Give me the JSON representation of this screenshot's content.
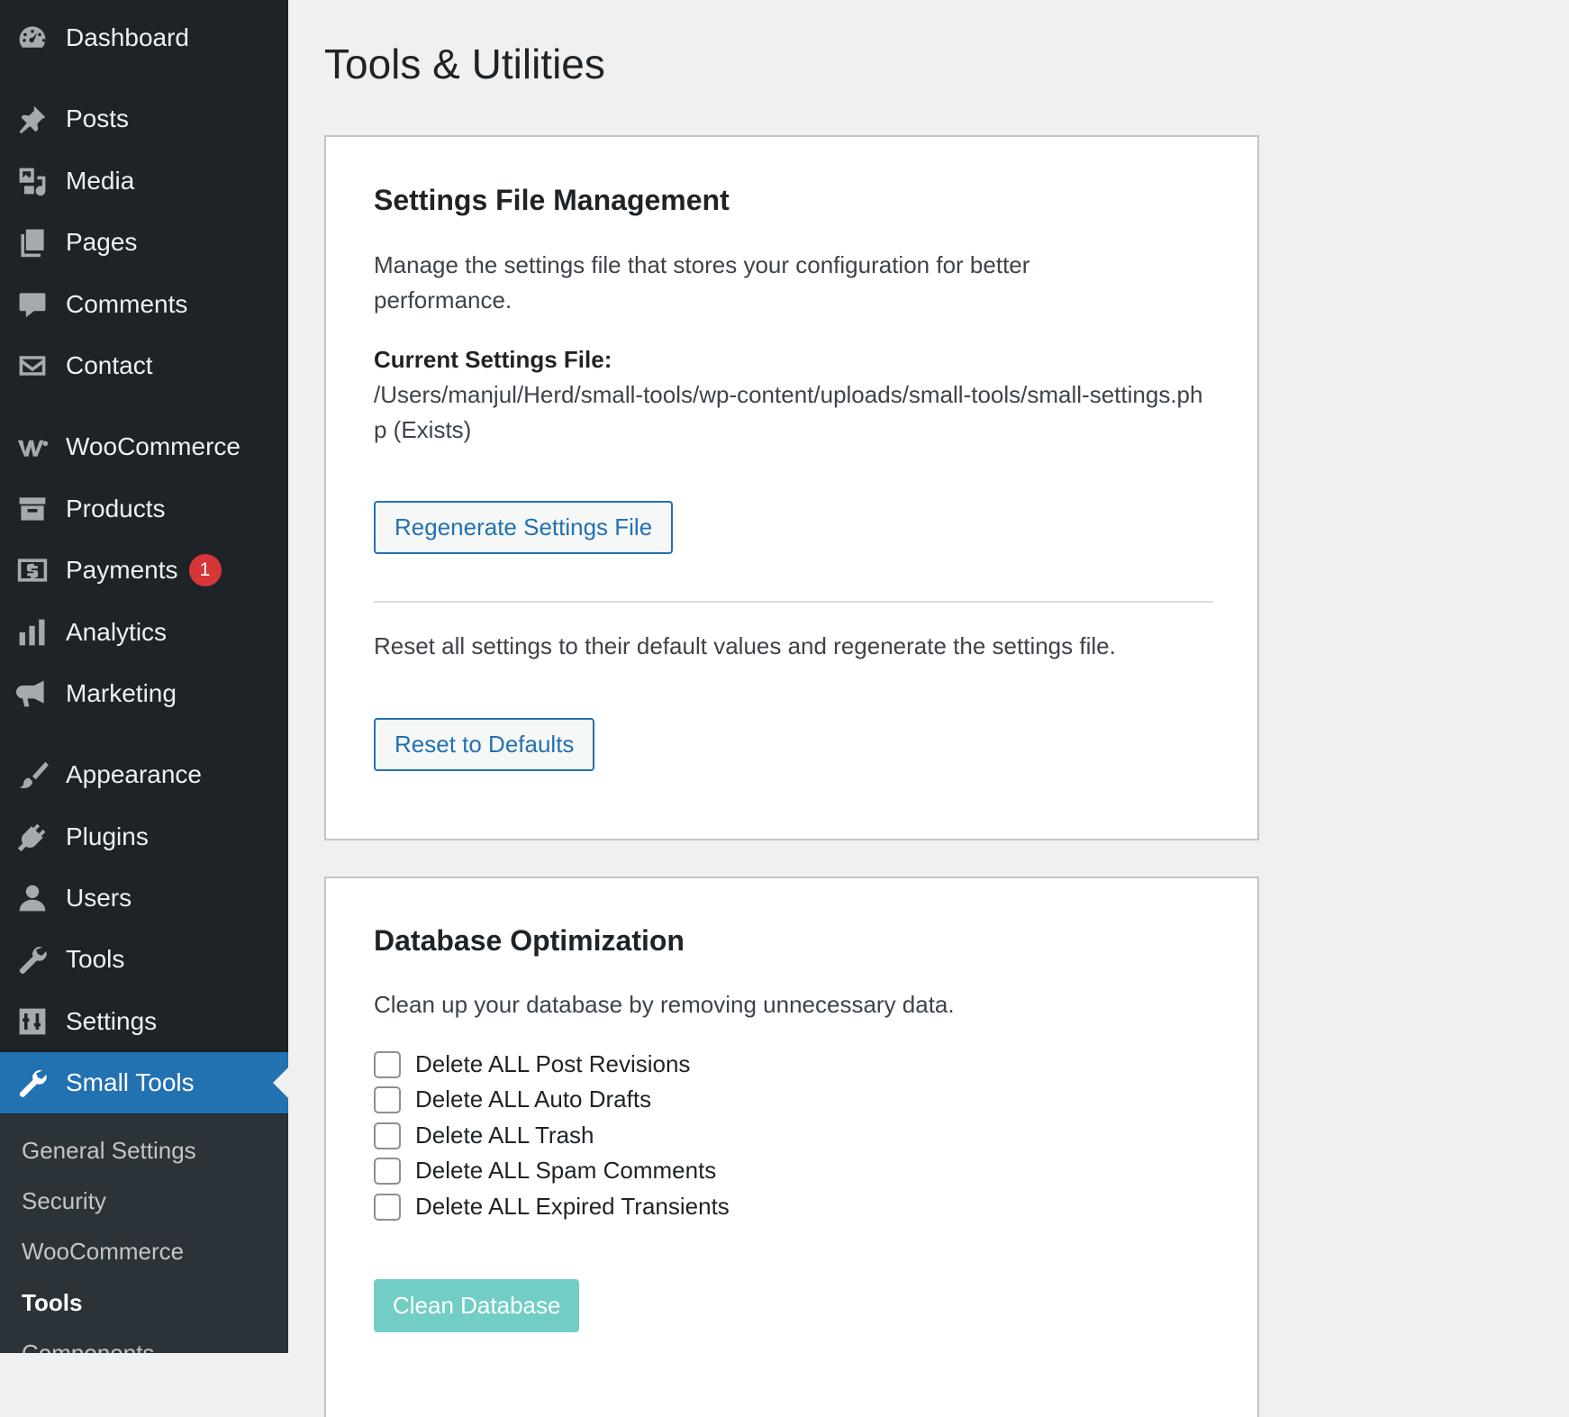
{
  "sidebar": {
    "items": [
      {
        "label": "Dashboard",
        "icon": "dashboard-icon"
      },
      {
        "label": "Posts",
        "icon": "pin-icon"
      },
      {
        "label": "Media",
        "icon": "media-icon"
      },
      {
        "label": "Pages",
        "icon": "pages-icon"
      },
      {
        "label": "Comments",
        "icon": "comment-icon"
      },
      {
        "label": "Contact",
        "icon": "envelope-icon"
      },
      {
        "label": "WooCommerce",
        "icon": "woocommerce-icon"
      },
      {
        "label": "Products",
        "icon": "archive-icon"
      },
      {
        "label": "Payments",
        "icon": "dollar-icon",
        "badge": "1"
      },
      {
        "label": "Analytics",
        "icon": "bar-chart-icon"
      },
      {
        "label": "Marketing",
        "icon": "megaphone-icon"
      },
      {
        "label": "Appearance",
        "icon": "paintbrush-icon"
      },
      {
        "label": "Plugins",
        "icon": "plug-icon"
      },
      {
        "label": "Users",
        "icon": "user-icon"
      },
      {
        "label": "Tools",
        "icon": "wrench-icon"
      },
      {
        "label": "Settings",
        "icon": "sliders-icon"
      },
      {
        "label": "Small Tools",
        "icon": "wrench-icon"
      }
    ],
    "submenu": [
      "General Settings",
      "Security",
      "WooCommerce",
      "Tools",
      "Components"
    ],
    "current_submenu": "Tools"
  },
  "page": {
    "title": "Tools & Utilities"
  },
  "settings_card": {
    "heading": "Settings File Management",
    "description": "Manage the settings file that stores your configuration for better performance.",
    "current_label": "Current Settings File:",
    "current_path": "/Users/manjul/Herd/small-tools/wp-content/uploads/small-tools/small-settings.php (Exists)",
    "regenerate_button": "Regenerate Settings File",
    "reset_description": "Reset all settings to their default values and regenerate the settings file.",
    "reset_button": "Reset to Defaults"
  },
  "db_card": {
    "heading": "Database Optimization",
    "description": "Clean up your database by removing unnecessary data.",
    "options": [
      {
        "label": "Delete ALL Post Revisions",
        "checked": false
      },
      {
        "label": "Delete ALL Auto Drafts",
        "checked": false
      },
      {
        "label": "Delete ALL Trash",
        "checked": false
      },
      {
        "label": "Delete ALL Spam Comments",
        "checked": false
      },
      {
        "label": "Delete ALL Expired Transients",
        "checked": false
      }
    ],
    "clean_button": "Clean Database"
  },
  "colors": {
    "sidebar_bg": "#1d2327",
    "submenu_bg": "#2c3338",
    "accent": "#2271b1",
    "badge": "#d63638",
    "primary_button_disabled": "#72cec4",
    "page_bg": "#f0f0f1"
  }
}
